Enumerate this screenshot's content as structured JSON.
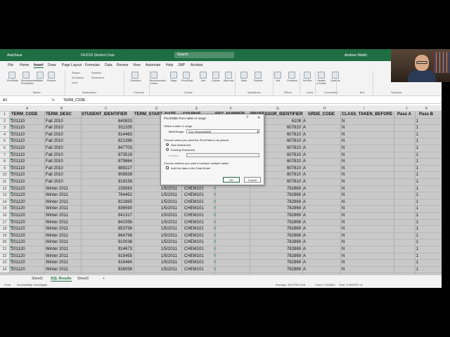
{
  "titlebar": {
    "autosave": "AutoSave",
    "document": "FA2016 Student Data",
    "search": "Search",
    "user": "Andrew Walsh",
    "minimize": "–",
    "maximize": "□",
    "close": "✕"
  },
  "menu": [
    "File",
    "Home",
    "Insert",
    "Draw",
    "Page Layout",
    "Formulas",
    "Data",
    "Review",
    "View",
    "Automate",
    "Help",
    "JMP",
    "Acrobat"
  ],
  "ribbon": {
    "buttons": [
      "PivotTable",
      "Recommended PivotTables",
      "Table",
      "Pictures",
      "Checkbox",
      "Recommended Charts",
      "Maps",
      "PivotChart",
      "Line",
      "Column",
      "Win/Loss",
      "Slicer",
      "Timeline",
      "Link",
      "Comment",
      "Text Box",
      "Header & Footer",
      "Symbols"
    ],
    "small": [
      "Shapes",
      "3D Models",
      "Icons",
      "SmartArt",
      "Screenshot"
    ],
    "groups": [
      "Tables",
      "Illustrations",
      "Controls",
      "Charts",
      "Sparklines",
      "Filters",
      "Links",
      "Comments",
      "Text",
      "Symbols"
    ]
  },
  "formula_bar": {
    "name_box": "A2",
    "fx": "fx",
    "value": "TERM_CODE"
  },
  "columns": [
    "A",
    "B",
    "C",
    "D",
    "E",
    "F",
    "G",
    "H",
    "I",
    "J",
    "K"
  ],
  "headers": [
    "TERM_CODE",
    "TERM_DESC",
    "STUDENT_IDENTIFIER",
    "TERM_START_DATE",
    "COURSE",
    "SEC_NUMBER",
    "PROFESSOR_IDENTIFIER",
    "GRDE_CODE",
    "CLASS_TAKEN_BEFORE",
    "Pass A",
    "Pass B"
  ],
  "rows": [
    {
      "n": "2",
      "term": "201110",
      "desc": "Fall 2010",
      "sid": "840833",
      "date": "",
      "course": "",
      "sec": "",
      "prof": "6108",
      "grade": "A",
      "before": "N",
      "pass": "1"
    },
    {
      "n": "3",
      "term": "201110",
      "desc": "Fall 2010",
      "sid": "911335",
      "date": "",
      "course": "",
      "sec": "",
      "prof": "607810",
      "grade": "A",
      "before": "N",
      "pass": "1"
    },
    {
      "n": "4",
      "term": "201110",
      "desc": "Fall 2010",
      "sid": "914463",
      "date": "",
      "course": "",
      "sec": "",
      "prof": "607810",
      "grade": "A",
      "before": "N",
      "pass": "1"
    },
    {
      "n": "5",
      "term": "201110",
      "desc": "Fall 2010",
      "sid": "821396",
      "date": "",
      "course": "",
      "sec": "",
      "prof": "607810",
      "grade": "A",
      "before": "N",
      "pass": "1"
    },
    {
      "n": "6",
      "term": "201110",
      "desc": "Fall 2010",
      "sid": "847703",
      "date": "",
      "course": "",
      "sec": "",
      "prof": "607810",
      "grade": "A",
      "before": "N",
      "pass": "1"
    },
    {
      "n": "7",
      "term": "201110",
      "desc": "Fall 2010",
      "sid": "873519",
      "date": "",
      "course": "",
      "sec": "",
      "prof": "607810",
      "grade": "A",
      "before": "N",
      "pass": "1"
    },
    {
      "n": "8",
      "term": "201110",
      "desc": "Fall 2010",
      "sid": "879864",
      "date": "",
      "course": "",
      "sec": "",
      "prof": "607810",
      "grade": "A",
      "before": "N",
      "pass": "1"
    },
    {
      "n": "9",
      "term": "201110",
      "desc": "Fall 2010",
      "sid": "889227",
      "date": "",
      "course": "",
      "sec": "",
      "prof": "607810",
      "grade": "A",
      "before": "N",
      "pass": "1"
    },
    {
      "n": "10",
      "term": "201110",
      "desc": "Fall 2010",
      "sid": "908939",
      "date": "",
      "course": "",
      "sec": "",
      "prof": "607810",
      "grade": "A",
      "before": "N",
      "pass": "1"
    },
    {
      "n": "11",
      "term": "201110",
      "desc": "Fall 2010",
      "sid": "919158",
      "date": "",
      "course": "",
      "sec": "",
      "prof": "607810",
      "grade": "A",
      "before": "N",
      "pass": "1"
    },
    {
      "n": "12",
      "term": "201120",
      "desc": "Winter 2011",
      "sid": "235563",
      "date": "1/5/2011",
      "course": "CHEM101",
      "sec": "0",
      "prof": "782869",
      "grade": "A",
      "before": "N",
      "pass": "1"
    },
    {
      "n": "13",
      "term": "201120",
      "desc": "Winter 2011",
      "sid": "784452",
      "date": "1/5/2011",
      "course": "CHEM101",
      "sec": "0",
      "prof": "782869",
      "grade": "A",
      "before": "N",
      "pass": "1"
    },
    {
      "n": "14",
      "term": "201120",
      "desc": "Winter 2011",
      "sid": "821865",
      "date": "1/5/2011",
      "course": "CHEM101",
      "sec": "0",
      "prof": "782869",
      "grade": "A",
      "before": "N",
      "pass": "1"
    },
    {
      "n": "15",
      "term": "201120",
      "desc": "Winter 2011",
      "sid": "836590",
      "date": "1/5/2011",
      "course": "CHEM101",
      "sec": "0",
      "prof": "782869",
      "grade": "A",
      "before": "N",
      "pass": "1"
    },
    {
      "n": "16",
      "term": "201120",
      "desc": "Winter 2011",
      "sid": "841317",
      "date": "1/5/2011",
      "course": "CHEM101",
      "sec": "0",
      "prof": "782869",
      "grade": "A",
      "before": "N",
      "pass": "1"
    },
    {
      "n": "17",
      "term": "201120",
      "desc": "Winter 2011",
      "sid": "842356",
      "date": "1/5/2011",
      "course": "CHEM101",
      "sec": "0",
      "prof": "782869",
      "grade": "A",
      "before": "N",
      "pass": "1"
    },
    {
      "n": "18",
      "term": "201120",
      "desc": "Winter 2011",
      "sid": "853756",
      "date": "1/5/2011",
      "course": "CHEM101",
      "sec": "0",
      "prof": "782869",
      "grade": "A",
      "before": "N",
      "pass": "1"
    },
    {
      "n": "19",
      "term": "201120",
      "desc": "Winter 2011",
      "sid": "864798",
      "date": "1/5/2011",
      "course": "CHEM101",
      "sec": "0",
      "prof": "782869",
      "grade": "A",
      "before": "N",
      "pass": "1"
    },
    {
      "n": "20",
      "term": "201120",
      "desc": "Winter 2011",
      "sid": "910036",
      "date": "1/5/2011",
      "course": "CHEM101",
      "sec": "0",
      "prof": "782869",
      "grade": "A",
      "before": "N",
      "pass": "1"
    },
    {
      "n": "21",
      "term": "201120",
      "desc": "Winter 2011",
      "sid": "914673",
      "date": "1/5/2011",
      "course": "CHEM101",
      "sec": "0",
      "prof": "782869",
      "grade": "A",
      "before": "N",
      "pass": "1"
    },
    {
      "n": "22",
      "term": "201120",
      "desc": "Winter 2011",
      "sid": "915455",
      "date": "1/5/2011",
      "course": "CHEM101",
      "sec": "0",
      "prof": "782869",
      "grade": "A",
      "before": "N",
      "pass": "1"
    },
    {
      "n": "23",
      "term": "201120",
      "desc": "Winter 2011",
      "sid": "916464",
      "date": "1/5/2011",
      "course": "CHEM101",
      "sec": "0",
      "prof": "782869",
      "grade": "A",
      "before": "N",
      "pass": "1"
    },
    {
      "n": "24",
      "term": "201120",
      "desc": "Winter 2011",
      "sid": "926058",
      "date": "1/5/2011",
      "course": "CHEM101",
      "sec": "0",
      "prof": "782869",
      "grade": "A",
      "before": "N",
      "pass": "1"
    }
  ],
  "dialog": {
    "title": "PivotTable from table or range",
    "help": "?",
    "close": "✕",
    "section1": "Select a table or range",
    "range_label": "Table/Range:",
    "range_value": "SQL Results!$A$1",
    "section2": "Choose where you want the PivotTable to be placed",
    "opt_new": "New Worksheet",
    "opt_existing": "Existing Worksheet",
    "location_label": "Location:",
    "section3": "Choose whether you want to analyze multiple tables",
    "data_model": "Add this data to the Data Model",
    "ok": "OK",
    "cancel": "Cancel"
  },
  "sheets": [
    "Sheet2",
    "SQL Results",
    "Sheet3"
  ],
  "add_sheet": "+",
  "status": {
    "ready": "Point",
    "accessibility": "Accessibility: Investigate",
    "average": "Average: 2007756.1126",
    "count": "Count: 1764063",
    "sum": "Sum: 2.45997E+11"
  },
  "colors": {
    "excel_green": "#1f6e43",
    "selection": "#c9c9c9"
  }
}
